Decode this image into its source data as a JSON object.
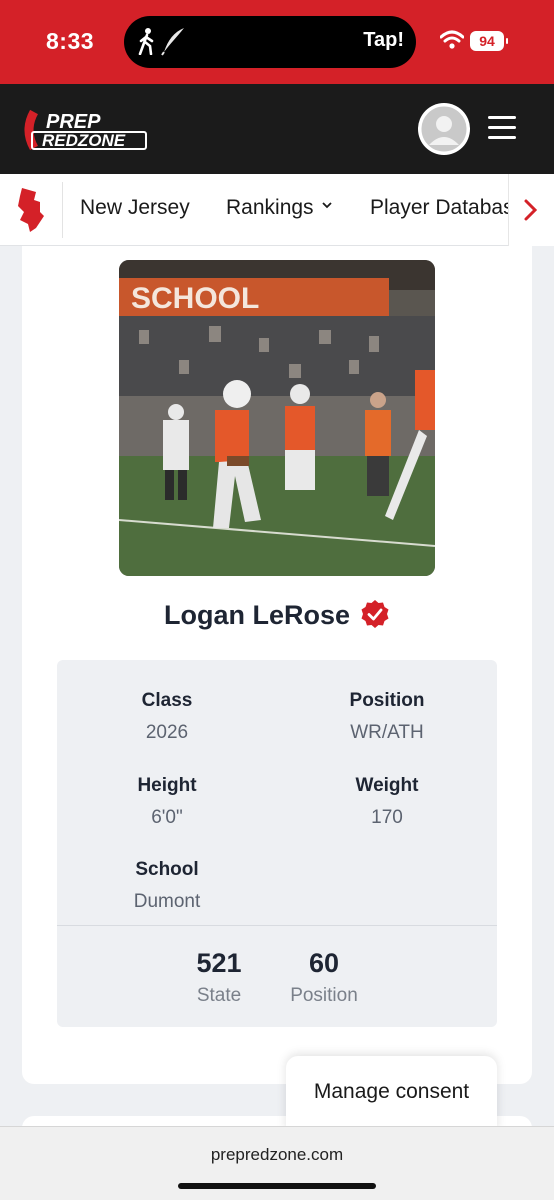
{
  "status_bar": {
    "time": "8:33",
    "activity_label": "Tap!",
    "battery": "94",
    "background_color": "#d42128"
  },
  "header": {
    "logo_line1": "PREP",
    "logo_line2": "REDZONE",
    "brand_color": "#d42128",
    "icons": [
      "avatar-icon",
      "hamburger-menu-icon"
    ]
  },
  "nav": {
    "state_icon": "new-jersey-map-icon",
    "items": [
      {
        "label": "New Jersey"
      },
      {
        "label": "Rankings",
        "has_dropdown": true
      },
      {
        "label": "Player Databas"
      }
    ],
    "next_icon": "chevron-right-icon"
  },
  "profile": {
    "name": "Logan LeRose",
    "verified": true,
    "photo_banner_text": "SCHOOL",
    "fields": {
      "class": {
        "label": "Class",
        "value": "2026"
      },
      "position": {
        "label": "Position",
        "value": "WR/ATH"
      },
      "height": {
        "label": "Height",
        "value": "6'0\""
      },
      "weight": {
        "label": "Weight",
        "value": "170"
      },
      "school": {
        "label": "School",
        "value": "Dumont"
      }
    },
    "rankings": [
      {
        "number": "521",
        "caption": "State"
      },
      {
        "number": "60",
        "caption": "Position"
      }
    ]
  },
  "consent": {
    "label": "Manage consent"
  },
  "browser": {
    "url": "prepredzone.com"
  }
}
